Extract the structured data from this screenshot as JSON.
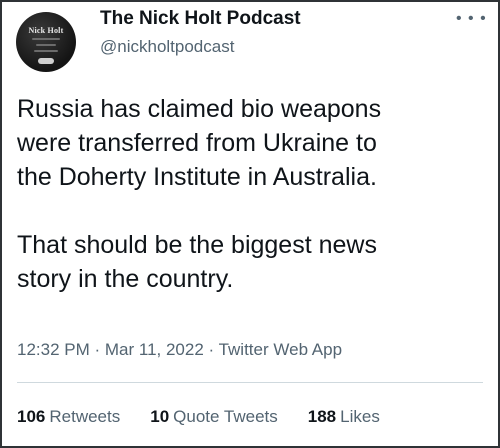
{
  "author": {
    "display_name": "The Nick Holt Podcast",
    "handle": "@nickholtpodcast",
    "avatar_text": "Nick Holt"
  },
  "more_icon": "more-horizontal-icon",
  "tweet": {
    "paragraph_1": "Russia has claimed bio weapons\nwere transferred from Ukraine to\nthe Doherty Institute in Australia.",
    "paragraph_2": "That should be the biggest news\nstory in the country."
  },
  "meta": {
    "text": "12:32 PM · Mar 11, 2022 · Twitter Web App"
  },
  "stats": {
    "retweets_count": "106",
    "retweets_label": "Retweets",
    "quotes_count": "10",
    "quotes_label": "Quote Tweets",
    "likes_count": "188",
    "likes_label": "Likes"
  },
  "colors": {
    "text_primary": "#0f1419",
    "text_secondary": "#536471",
    "divider": "#cfd9de"
  }
}
